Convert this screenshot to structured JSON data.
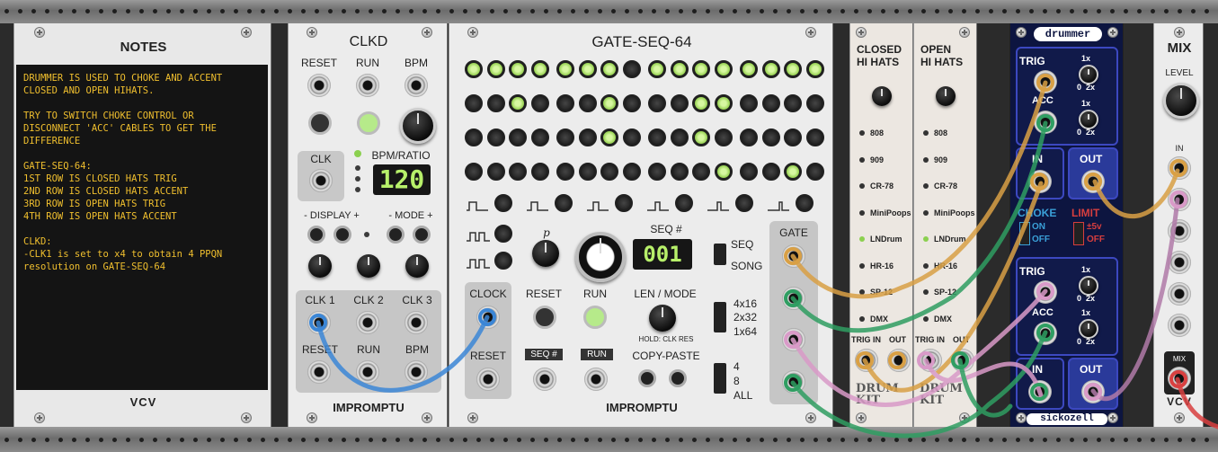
{
  "notes": {
    "title": "NOTES",
    "lines": [
      "DRUMMER IS USED TO CHOKE AND ACCENT",
      "CLOSED AND OPEN HIHATS.",
      "",
      "TRY TO SWITCH CHOKE CONTROL OR",
      "DISCONNECT 'ACC' CABLES TO GET THE",
      "DIFFERENCE",
      "",
      "GATE-SEQ-64:",
      "1ST ROW IS CLOSED HATS TRIG",
      "2ND ROW IS CLOSED HATS ACCENT",
      "3RD ROW IS OPEN HATS TRIG",
      "4TH ROW IS OPEN HATS ACCENT",
      "",
      "CLKD:",
      "-CLK1 is set to x4 to obtain 4 PPQN",
      "resolution on GATE-SEQ-64"
    ],
    "brand": "VCV"
  },
  "clkd": {
    "title": "CLKD",
    "reset": "RESET",
    "run": "RUN",
    "bpm": "BPM",
    "clk": "CLK",
    "bpm_ratio": "BPM/RATIO",
    "display_value": "120",
    "display": "- DISPLAY +",
    "mode": "- MODE +",
    "clk1": "CLK 1",
    "clk2": "CLK 2",
    "clk3": "CLK 3",
    "reset2": "RESET",
    "run2": "RUN",
    "bpm2": "BPM",
    "brand": "IMPROMPTU"
  },
  "gateseq": {
    "title": "GATE-SEQ-64",
    "rows": [
      [
        1,
        1,
        1,
        1,
        1,
        1,
        1,
        0,
        1,
        1,
        1,
        1,
        1,
        1,
        1,
        1
      ],
      [
        0,
        0,
        1,
        0,
        0,
        0,
        1,
        0,
        0,
        0,
        1,
        1,
        0,
        0,
        0,
        0
      ],
      [
        0,
        0,
        0,
        0,
        0,
        0,
        1,
        0,
        0,
        0,
        1,
        0,
        0,
        0,
        0,
        0
      ],
      [
        0,
        0,
        0,
        0,
        0,
        0,
        0,
        0,
        0,
        0,
        0,
        1,
        0,
        0,
        1,
        0
      ]
    ],
    "seq_num_label": "SEQ #",
    "seq_num_value": "001",
    "seq": "SEQ",
    "song": "SONG",
    "gate": "GATE",
    "clock": "CLOCK",
    "reset": "RESET",
    "reset_btn": "RESET",
    "run": "RUN",
    "len_mode": "LEN / MODE",
    "hold": "HOLD: CLK RES",
    "seqnum_btn": "SEQ #",
    "run_btn": "RUN",
    "copy_paste": "COPY-PASTE",
    "len_opts": [
      "4x16",
      "2x32",
      "1x64"
    ],
    "copy_opts": [
      "4",
      "8",
      "ALL"
    ],
    "p_label": "p",
    "brand": "IMPROMPTU"
  },
  "drumkit": {
    "closed_title": "CLOSED\nHI HATS",
    "open_title": "OPEN\nHI HATS",
    "kits": [
      "808",
      "909",
      "CR-78",
      "MiniPoops",
      "LNDrum",
      "HR-16",
      "SP-12",
      "DMX"
    ],
    "closed_selected": 4,
    "open_selected": 4,
    "trig_in": "TRIG IN",
    "out": "OUT",
    "logo": "DRUM KIT"
  },
  "drummer": {
    "title": "drummer",
    "trig": "TRIG",
    "acc": "ACC",
    "in": "IN",
    "out": "OUT",
    "x1": "1x",
    "range": "0  2x",
    "choke": "CHOKE",
    "choke_on": "ON",
    "choke_off": "OFF",
    "limit": "LIMIT",
    "limit_on": "±5v",
    "limit_off": "OFF",
    "brand": "sickozell",
    "colors": {
      "panel": "#0d1540",
      "accent": "#d63e3e",
      "choke": "#3aa0d8"
    }
  },
  "mix": {
    "title": "MIX",
    "level": "LEVEL",
    "in": "IN",
    "mix": "MIX",
    "brand": "VCV"
  },
  "cable_colors": {
    "blue": "#3b86d6",
    "orange": "#d9a045",
    "green": "#2f9e62",
    "pink": "#d99ac8",
    "red": "#d94040",
    "mauve": "#b07aa8"
  }
}
